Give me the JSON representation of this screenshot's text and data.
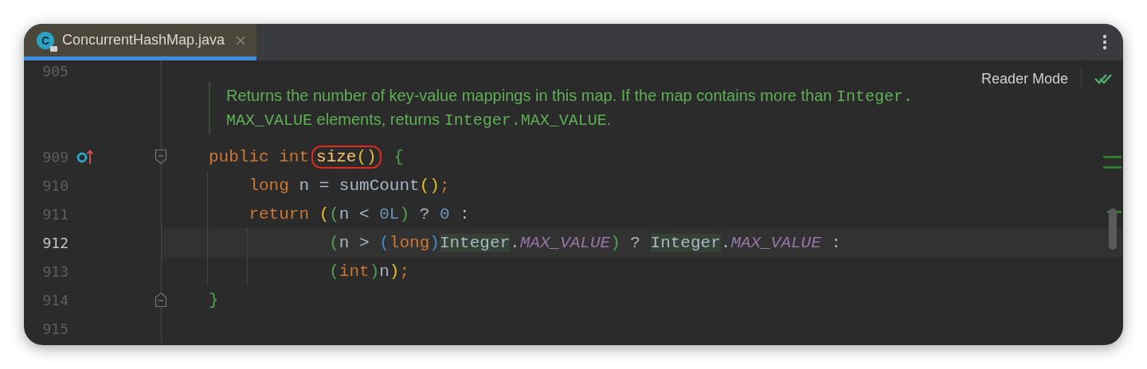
{
  "tabs": [
    {
      "label": "ConcurrentHashMap.java",
      "icon_letter": "C",
      "selected": true
    }
  ],
  "reader_mode": {
    "label": "Reader Mode"
  },
  "top_line": {
    "number": "905"
  },
  "doc": {
    "lines": [
      [
        {
          "kind": "text",
          "text": "Returns the number of key-value mappings in this map. If the map contains more than "
        },
        {
          "kind": "code",
          "text": "Integer."
        }
      ],
      [
        {
          "kind": "code",
          "text": "MAX_VALUE"
        },
        {
          "kind": "text",
          "text": " elements, returns "
        },
        {
          "kind": "code",
          "text": "Integer.MAX_VALUE"
        },
        {
          "kind": "text",
          "text": "."
        }
      ]
    ]
  },
  "lines": [
    {
      "number": "909",
      "current": false,
      "gutter_mark": true,
      "fold_open": true,
      "fold_close": false,
      "tokens": [
        {
          "kind": "keyword",
          "text": "public "
        },
        {
          "kind": "keyword",
          "text": "int"
        },
        {
          "kind": "circle",
          "tokens": [
            {
              "kind": "method",
              "text": "size"
            },
            {
              "kind": "paren1",
              "text": "()"
            }
          ]
        },
        {
          "kind": "paren2",
          "text": " {"
        }
      ]
    },
    {
      "number": "910",
      "current": false,
      "gutter_mark": false,
      "fold_open": false,
      "fold_close": false,
      "tokens": [
        {
          "kind": "keyword",
          "text": "    long"
        },
        {
          "kind": "plain",
          "text": " n = sumCount"
        },
        {
          "kind": "paren1",
          "text": "()"
        },
        {
          "kind": "keyword",
          "text": ";"
        }
      ]
    },
    {
      "number": "911",
      "current": false,
      "gutter_mark": false,
      "fold_open": false,
      "fold_close": false,
      "tokens": [
        {
          "kind": "keyword",
          "text": "    return "
        },
        {
          "kind": "paren1",
          "text": "("
        },
        {
          "kind": "paren2",
          "text": "("
        },
        {
          "kind": "plain",
          "text": "n < "
        },
        {
          "kind": "number",
          "text": "0L"
        },
        {
          "kind": "paren2",
          "text": ")"
        },
        {
          "kind": "plain",
          "text": " ? "
        },
        {
          "kind": "number",
          "text": "0"
        },
        {
          "kind": "plain",
          "text": " :"
        }
      ]
    },
    {
      "number": "912",
      "current": true,
      "gutter_mark": false,
      "fold_open": false,
      "fold_close": false,
      "tokens": [
        {
          "kind": "paren2",
          "text": "            ("
        },
        {
          "kind": "plain",
          "text": "n > "
        },
        {
          "kind": "paren3",
          "text": "("
        },
        {
          "kind": "keyword",
          "text": "long"
        },
        {
          "kind": "paren3",
          "text": ")"
        },
        {
          "kind": "class-ref",
          "text": "Integer"
        },
        {
          "kind": "plain",
          "text": "."
        },
        {
          "kind": "constant",
          "text": "MAX_VALUE"
        },
        {
          "kind": "paren2",
          "text": ")"
        },
        {
          "kind": "plain",
          "text": " ? "
        },
        {
          "kind": "class-ref",
          "text": "Integer"
        },
        {
          "kind": "plain",
          "text": "."
        },
        {
          "kind": "constant",
          "text": "MAX_VALUE"
        },
        {
          "kind": "plain",
          "text": " :"
        }
      ]
    },
    {
      "number": "913",
      "current": false,
      "gutter_mark": false,
      "fold_open": false,
      "fold_close": false,
      "tokens": [
        {
          "kind": "paren2",
          "text": "            ("
        },
        {
          "kind": "keyword",
          "text": "int"
        },
        {
          "kind": "paren2",
          "text": ")"
        },
        {
          "kind": "plain",
          "text": "n"
        },
        {
          "kind": "paren1",
          "text": ")"
        },
        {
          "kind": "keyword",
          "text": ";"
        }
      ]
    },
    {
      "number": "914",
      "current": false,
      "gutter_mark": false,
      "fold_open": false,
      "fold_close": true,
      "tokens": [
        {
          "kind": "paren2",
          "text": "}"
        }
      ]
    },
    {
      "number": "915",
      "current": false,
      "gutter_mark": false,
      "fold_open": false,
      "fold_close": false
    }
  ]
}
